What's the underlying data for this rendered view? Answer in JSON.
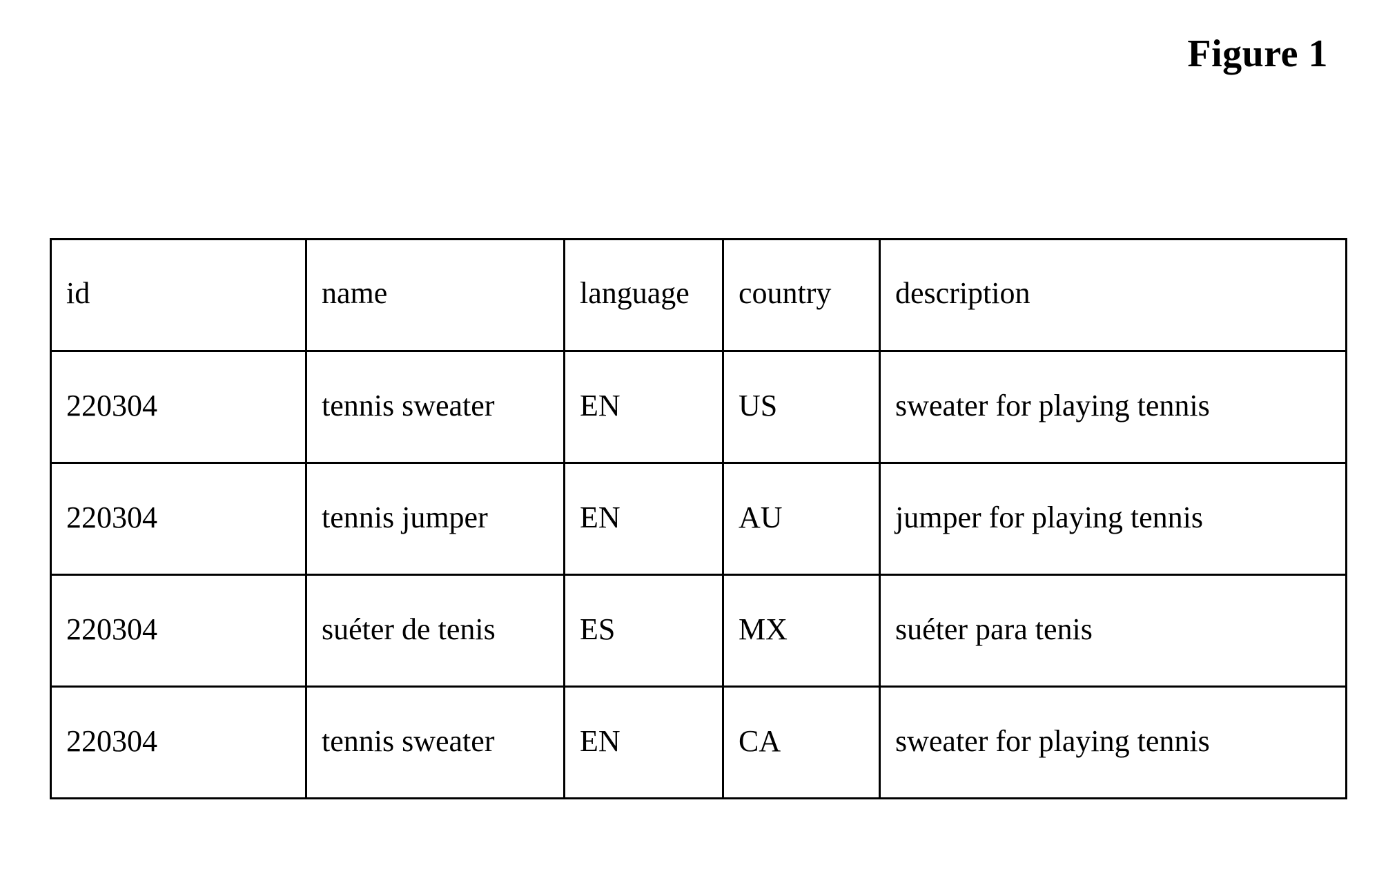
{
  "figure": {
    "title": "Figure 1"
  },
  "table": {
    "columns": [
      "id",
      "name",
      "language",
      "country",
      "description"
    ],
    "rows": [
      [
        "220304",
        "tennis sweater",
        "EN",
        "US",
        "sweater for playing tennis"
      ],
      [
        "220304",
        "tennis jumper",
        "EN",
        "AU",
        "jumper for playing tennis"
      ],
      [
        "220304",
        "suéter de tenis",
        "ES",
        "MX",
        "suéter para tenis"
      ],
      [
        "220304",
        "tennis sweater",
        "EN",
        "CA",
        "sweater for playing tennis"
      ]
    ]
  }
}
